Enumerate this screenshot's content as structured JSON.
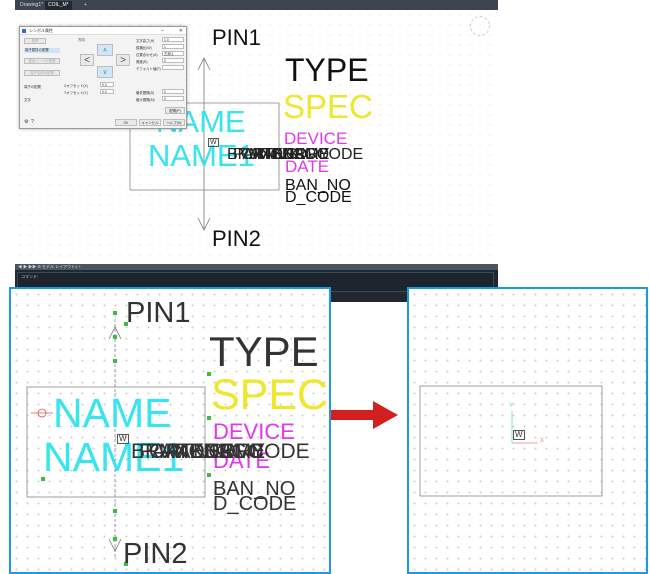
{
  "cad": {
    "tabs": [
      "Drawing1*",
      "COIL_M*",
      "+"
    ],
    "layout_bar": "◀ ▶ ▶▶ ☰ モデル レイアウト1 +",
    "command_label": "コマンド:"
  },
  "dialog": {
    "title": "シンボル属性",
    "left_items": [
      "基準",
      "端子属性の配置",
      "部品シートの配置",
      "端子名称の配置",
      "端子の配置",
      "文字"
    ],
    "orientation_label": "方向",
    "arrow_up": "∧",
    "arrow_left": "<",
    "arrow_right": ">",
    "arrow_down": "∨",
    "offset_x_label": "Xオフセット(X)",
    "offset_x_value": "0.0",
    "offset_y_label": "Yオフセット(Y)",
    "offset_y_value": "0.0",
    "right_labels": [
      "文字高さ(H)",
      "縦横比(W)",
      "位置合わせ(A)",
      "角度(R)",
      "デフォルト値(F)",
      "最低間隔(D)",
      "最大間隔(M)"
    ],
    "right_values": [
      "1.0",
      "1",
      "左揃え",
      "0",
      "",
      "0",
      "0"
    ],
    "apply_button": "配置(P)",
    "ok_button": "OK",
    "cancel_button": "キャンセル",
    "help_button": "ヘルプ(H)"
  },
  "symbol": {
    "pin1": "PIN1",
    "pin2": "PIN2",
    "type": "TYPE",
    "spec": "SPEC",
    "device": "DEVICE",
    "name": "NAME",
    "name1": "NAME1",
    "date_partial": "DATE",
    "overlap_texts": [
      "BRANDNAME",
      "PARTNO",
      "CATEGORY",
      "MAKER",
      "MODEL",
      "KIGO",
      "CODE",
      "SERIES"
    ],
    "ban_no": "BAN_NO",
    "d_code": "D_CODE",
    "base_marker": "W",
    "axis_y": "Y",
    "axis_x": "X"
  },
  "colors": {
    "accent_blue": "#1b9be3",
    "arrow_red": "#d22020",
    "name_cyan": "#38e4f0",
    "spec_yellow": "#f0e62c",
    "device_magenta": "#e03ae8",
    "grip_green": "#3dbb3d",
    "cad_dark": "#212831"
  }
}
